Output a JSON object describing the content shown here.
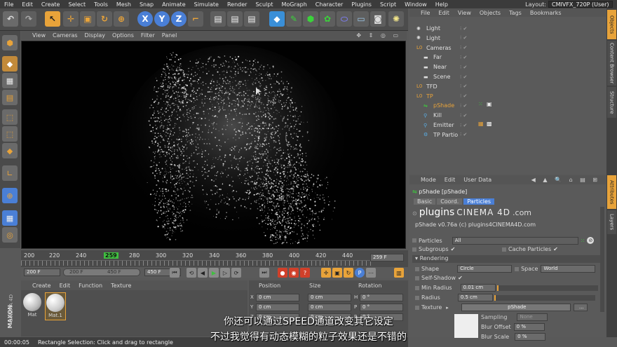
{
  "menubar": {
    "items": [
      "File",
      "Edit",
      "Create",
      "Select",
      "Tools",
      "Mesh",
      "Snap",
      "Animate",
      "Simulate",
      "Render",
      "Sculpt",
      "MoGraph",
      "Character",
      "Plugins",
      "Script",
      "Window",
      "Help"
    ],
    "layout_label": "Layout:",
    "layout_value": "CMIVFX_720P (User)"
  },
  "toolbar": {
    "x_axis": "X",
    "y_axis": "Y",
    "z_axis": "Z"
  },
  "viewport": {
    "menu": [
      "View",
      "Cameras",
      "Display",
      "Options",
      "Filter",
      "Panel"
    ]
  },
  "timeline": {
    "ticks": [
      "200",
      "220",
      "240",
      "259",
      "280",
      "300",
      "320",
      "340",
      "360",
      "380",
      "400",
      "420",
      "440"
    ],
    "current_frame": "259",
    "end_field": "259 F"
  },
  "playback": {
    "start": "200 F",
    "range_start": "200 F",
    "range_end": "450 F",
    "end": "450 F"
  },
  "material_manager": {
    "menu": [
      "Create",
      "Edit",
      "Function",
      "Texture"
    ],
    "materials": [
      "Mat",
      "Mat.1"
    ]
  },
  "coordinates": {
    "headers": [
      "Position",
      "Size",
      "Rotation"
    ],
    "rows": [
      {
        "axis": "X",
        "pos": "0 cm",
        "size": "0 cm",
        "rot_label": "H",
        "rot": "0 °"
      },
      {
        "axis": "Y",
        "pos": "0 cm",
        "size": "0 cm",
        "rot_label": "P",
        "rot": "0 °"
      },
      {
        "axis": "Z",
        "pos": "0 cm",
        "size": "0 cm",
        "rot_label": "B",
        "rot": "0 °"
      }
    ]
  },
  "status": {
    "time": "00:00:05",
    "message": "Rectangle Selection: Click and drag to rectangle"
  },
  "branding": {
    "maxon": "MAXON",
    "cinema": "CINEMA 4D"
  },
  "object_manager": {
    "menu": [
      "File",
      "Edit",
      "View",
      "Objects",
      "Tags",
      "Bookmarks"
    ],
    "objects": [
      "Light",
      "Light",
      "Cameras",
      "Far",
      "Near",
      "Scene",
      "TFD",
      "TP",
      "pShade",
      "Kill",
      "Emitter",
      "TP Partio"
    ]
  },
  "attribute_manager": {
    "menu": [
      "Mode",
      "Edit",
      "User Data"
    ],
    "title": "pShade [pShade]",
    "tabs": [
      "Basic",
      "Coord.",
      "Particles"
    ],
    "banner_left": "plugins",
    "banner_right": "CINEMA 4D",
    "banner_suffix": ".com",
    "version": "pShade v0.76a (c) plugins4CINEMA4D.com",
    "particles_label": "Particles",
    "particles_value": "All",
    "subgroups_label": "Subgroups",
    "cache_label": "Cache Particles",
    "rendering_section": "Rendering",
    "shape_label": "Shape",
    "shape_value": "Circle",
    "space_label": "Space",
    "space_value": "World",
    "selfshadow_label": "Self-Shadow",
    "minradius_label": "Min Radius",
    "minradius_value": "0.01 cm",
    "radius_label": "Radius",
    "radius_value": "0.5 cm",
    "texture_label": "Texture",
    "texture_value": "pShade",
    "sampling_label": "Sampling",
    "sampling_value": "None",
    "bluroffset_label": "Blur Offset",
    "bluroffset_value": "0 %",
    "blurscale_label": "Blur Scale",
    "blurscale_value": "0 %"
  },
  "right_tabs": [
    "Objects",
    "Content Browser",
    "Structure",
    "Attributes",
    "Layers"
  ],
  "subtitles": {
    "line1": "你还可以通过SPEED通道改变其它设定",
    "line2": "不过我觉得有动态模糊的粒子效果还是不错的"
  },
  "colors": {
    "accent_orange": "#e8a33a",
    "axis_blue": "#4a7fd6",
    "play_green": "#3fbf3f",
    "record_red": "#d0402a",
    "check_green": "#3bd23b"
  }
}
